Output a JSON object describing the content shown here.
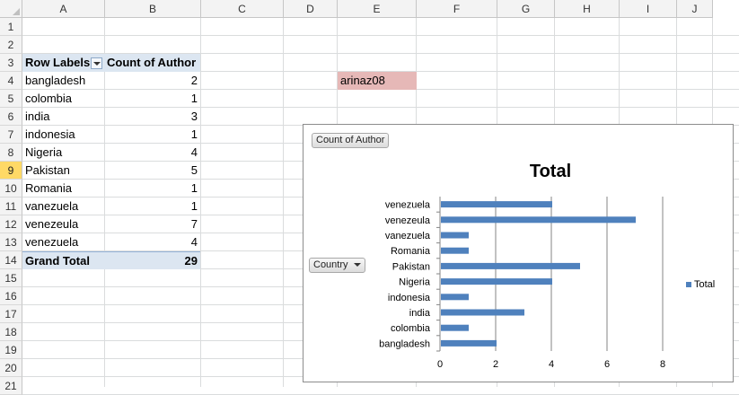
{
  "columns": [
    "A",
    "B",
    "C",
    "D",
    "E",
    "F",
    "G",
    "H",
    "I",
    "J"
  ],
  "rows": [
    "1",
    "2",
    "3",
    "4",
    "5",
    "6",
    "7",
    "8",
    "9",
    "10",
    "11",
    "12",
    "13",
    "14",
    "15",
    "16",
    "17",
    "18",
    "19",
    "20",
    "21"
  ],
  "selected_row": "9",
  "pivot": {
    "row_labels_header": "Row Labels",
    "value_header": "Count of Author",
    "rows": [
      {
        "label": "bangladesh",
        "value": "2"
      },
      {
        "label": "colombia",
        "value": "1"
      },
      {
        "label": "india",
        "value": "3"
      },
      {
        "label": "indonesia",
        "value": "1"
      },
      {
        "label": "Nigeria",
        "value": "4"
      },
      {
        "label": "Pakistan",
        "value": "5"
      },
      {
        "label": "Romania",
        "value": "1"
      },
      {
        "label": "vanezuela",
        "value": "1"
      },
      {
        "label": "venezeula",
        "value": "7"
      },
      {
        "label": "venezuela",
        "value": "4"
      }
    ],
    "grand_total_label": "Grand Total",
    "grand_total_value": "29"
  },
  "highlighted_cell": {
    "ref": "E4",
    "value": "arinaz08",
    "color": "#e6b8b7"
  },
  "chart_field_buttons": {
    "values_field": "Count of Author",
    "axis_field": "Country"
  },
  "chart_data": {
    "type": "bar",
    "orientation": "horizontal",
    "title": "Total",
    "categories": [
      "bangladesh",
      "colombia",
      "india",
      "indonesia",
      "Nigeria",
      "Pakistan",
      "Romania",
      "vanezuela",
      "venezeula",
      "venezuela"
    ],
    "series": [
      {
        "name": "Total",
        "values": [
          2,
          1,
          3,
          1,
          4,
          5,
          1,
          1,
          7,
          4
        ],
        "color": "#4f81bd"
      }
    ],
    "xlim": [
      0,
      8
    ],
    "x_ticks": [
      "0",
      "2",
      "4",
      "6",
      "8"
    ],
    "grid": true,
    "legend": "right"
  }
}
